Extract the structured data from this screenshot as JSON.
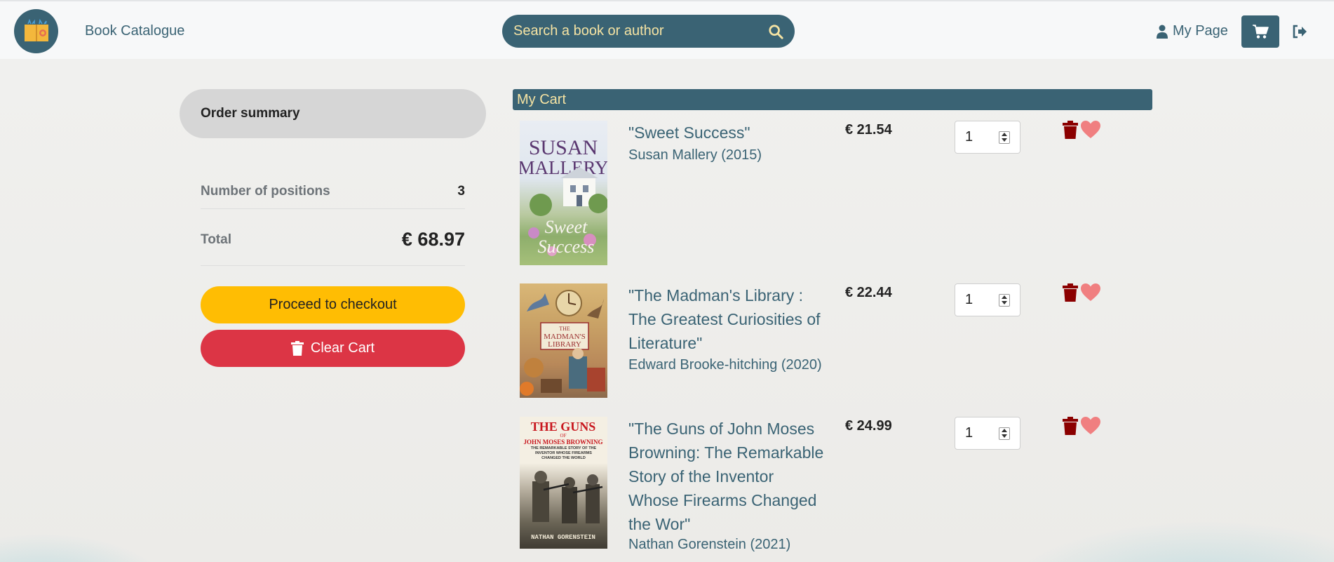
{
  "header": {
    "brand": "Book Catalogue",
    "search_placeholder": "Search a book or author",
    "mypage_label": "My Page"
  },
  "summary": {
    "title": "Order summary",
    "positions_label": "Number of positions",
    "positions_value": "3",
    "total_label": "Total",
    "total_value": "€ 68.97",
    "checkout_label": "Proceed to checkout",
    "clear_label": "Clear Cart"
  },
  "cart": {
    "title": "My Cart",
    "items": [
      {
        "title": "\"Sweet Success\"",
        "author": "Susan Mallery (2015)",
        "price": "€ 21.54",
        "qty": "1",
        "cover_text": [
          "SUSAN",
          "MALLERY",
          "Sweet",
          "Success"
        ]
      },
      {
        "title": "\"The Madman's Library : The Greatest Curiosities of Literature\"",
        "author": "Edward Brooke-hitching (2020)",
        "price": "€ 22.44",
        "qty": "1",
        "cover_text": [
          "THE",
          "MADMAN'S",
          "LIBRARY"
        ]
      },
      {
        "title": "\"The Guns of John Moses Browning: The Remarkable Story of the Inventor Whose Firearms Changed the Wor\"",
        "author": "Nathan Gorenstein (2021)",
        "price": "€ 24.99",
        "qty": "1",
        "cover_text": [
          "THE GUNS",
          "OF",
          "JOHN MOSES BROWNING",
          "THE REMARKABLE STORY OF THE INVENTOR WHOSE FIREARMS CHANGED THE WORLD",
          "NATHAN GORENSTEIN"
        ]
      }
    ]
  },
  "colors": {
    "primary": "#3a6374",
    "accent_text": "#f5e3a3",
    "checkout": "#ffbd03",
    "clear": "#dc3545",
    "trash": "#8b0000",
    "heart": "#f07f80"
  },
  "icons": [
    "book-logo-icon",
    "search-icon",
    "user-icon",
    "cart-icon",
    "logout-icon",
    "trash-icon",
    "heart-icon"
  ]
}
